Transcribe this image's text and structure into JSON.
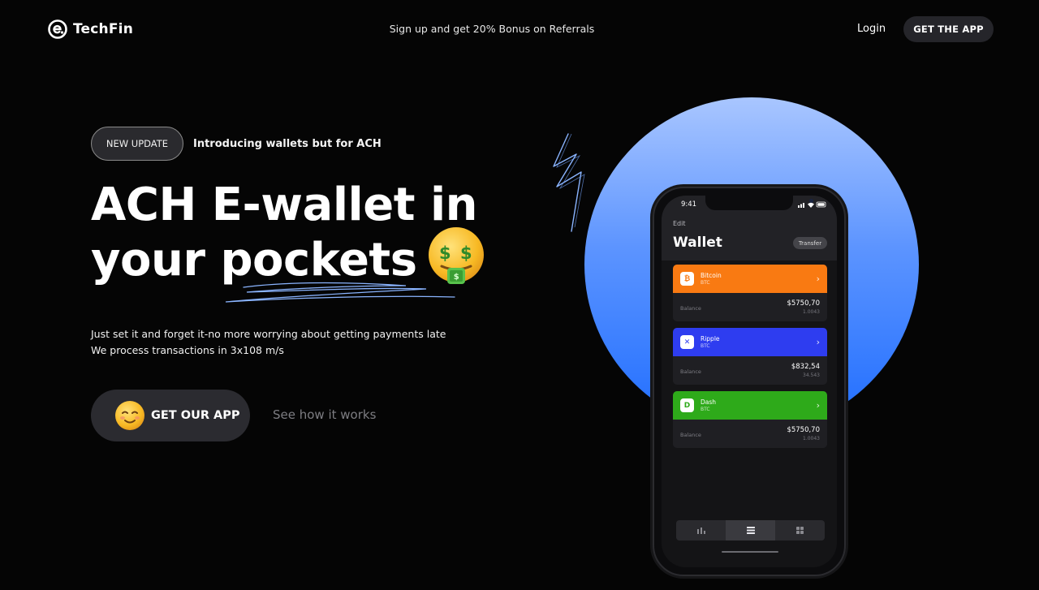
{
  "nav": {
    "brand": "TechFin",
    "promo": "Sign up and get 20% Bonus on Referrals",
    "login": "Login",
    "get_app": "GET THE APP"
  },
  "hero": {
    "badge": "NEW UPDATE",
    "badge_text": "Introducing wallets but for ACH",
    "headline_line1": "ACH E-wallet in",
    "headline_line2": "your pockets",
    "headline_emoji": "money-mouth-face-icon",
    "subtitle_line1": "Just set it and forget it-no more worrying about getting payments late",
    "subtitle_line2": "We process transactions in 3x108 m/s",
    "cta_label": "GET OUR APP",
    "cta_emoji": "smiling-face-icon",
    "secondary_link": "See how it works"
  },
  "phone": {
    "time": "9:41",
    "edit": "Edit",
    "title": "Wallet",
    "transfer": "Transfer",
    "balance_label": "Balance",
    "cards": [
      {
        "name": "Bitcoin",
        "symbol": "BTC",
        "balance": "$5750,70",
        "sub": "1.0043",
        "color": "#f97a12",
        "icon": "bitcoin-icon"
      },
      {
        "name": "Ripple",
        "symbol": "BTC",
        "balance": "$832,54",
        "sub": "34.543",
        "color": "#2e3df0",
        "icon": "ripple-icon"
      },
      {
        "name": "Dash",
        "symbol": "BTC",
        "balance": "$5750,70",
        "sub": "1.0043",
        "color": "#2eaa1a",
        "icon": "dash-icon"
      }
    ],
    "tabs": [
      "chart-icon",
      "wallet-list-icon",
      "grid-icon"
    ]
  },
  "colors": {
    "background": "#050505",
    "circle_top": "#a9c6ff",
    "circle_bottom": "#1f6dff",
    "button_bg": "#2b2b30"
  }
}
